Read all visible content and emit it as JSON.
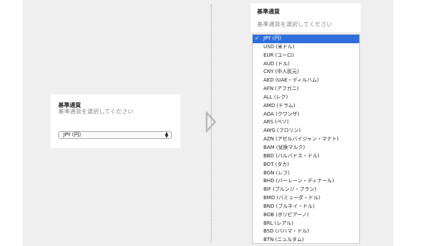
{
  "left_card": {
    "title": "基準通貨",
    "subtitle": "基準通貨を選択してください",
    "select_value": "JPY (円)"
  },
  "right_card": {
    "title": "基準通貨",
    "subtitle": "基準通貨を選択してください"
  },
  "dropdown": {
    "selected_check": "✓",
    "options": [
      "JPY (円)",
      "USD (米ドル)",
      "EUR (ユーロ)",
      "AUD (ドル)",
      "CNY (中人民元)",
      "AED (UAE・ディルハム)",
      "AFN (アフガニ)",
      "ALL (レク)",
      "AMD (ドラム)",
      "AOA (クワンザ)",
      "ARS (ペソ)",
      "AWG (フロリン)",
      "AZN (アゼルバイジャン・マナト)",
      "BAM (兌換マルク)",
      "BBD (バルバドス・ドル)",
      "BDT (タカ)",
      "BGN (レフ)",
      "BHD (バーレーン・ディナール)",
      "BIF (ブルンジ・フラン)",
      "BMD (バミューダ・ドル)",
      "BND (ブルネイ・ドル)",
      "BOB (ボリビアーノ)",
      "BRL (レアル)",
      "BSD (バハマ・ドル)",
      "BTN (ニュルタム)"
    ]
  },
  "colors": {
    "selected_bg": "#2f6fdd",
    "stage_bg": "#efefef",
    "arrow": "#b9b9b9"
  }
}
